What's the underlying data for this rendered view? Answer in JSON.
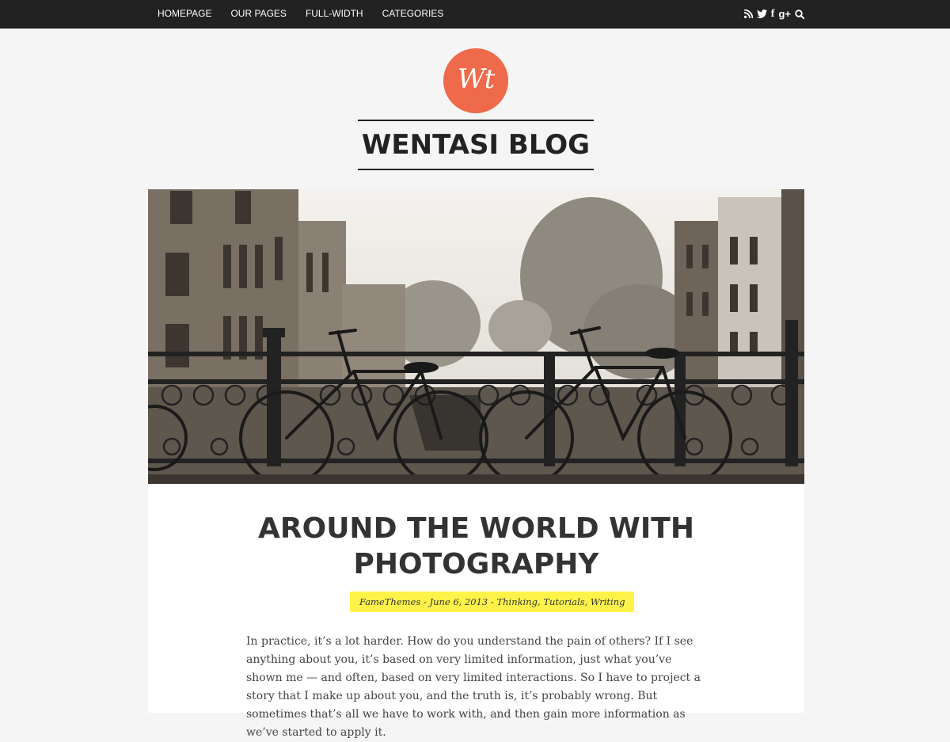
{
  "nav": {
    "items": [
      "HOMEPAGE",
      "OUR PAGES",
      "FULL-WIDTH",
      "CATEGORIES"
    ]
  },
  "social": {
    "icons": [
      "rss-icon",
      "twitter-icon",
      "facebook-icon",
      "google-plus-icon",
      "search-icon"
    ],
    "facebook_glyph": "f",
    "google_plus_glyph": "g+"
  },
  "logo": {
    "text": "Wt",
    "color": "#ef6a4b"
  },
  "site": {
    "title": "WENTASI BLOG"
  },
  "post": {
    "title": "AROUND THE WORLD WITH PHOTOGRAPHY",
    "meta": {
      "author": "FameThemes",
      "sep1": " - ",
      "date": "June 6, 2013",
      "sep2": " - ",
      "cat1": "Thinking",
      "comma1": ", ",
      "cat2": "Tutorials",
      "comma2": ", ",
      "cat3": "Writing"
    },
    "excerpt": "In practice, it’s a lot harder. How do you understand the pain of others? If I see anything about you, it’s based on very limited information, just what you’ve shown me — and often, based on very limited interactions. So I have to project a story that I make up about you, and the truth is, it’s probably wrong. But sometimes that’s all we have to work with, and then gain more information as we’ve started to apply it."
  },
  "colors": {
    "topbar": "#222222",
    "accent": "#ef6a4b",
    "meta_highlight": "#fff34a"
  }
}
